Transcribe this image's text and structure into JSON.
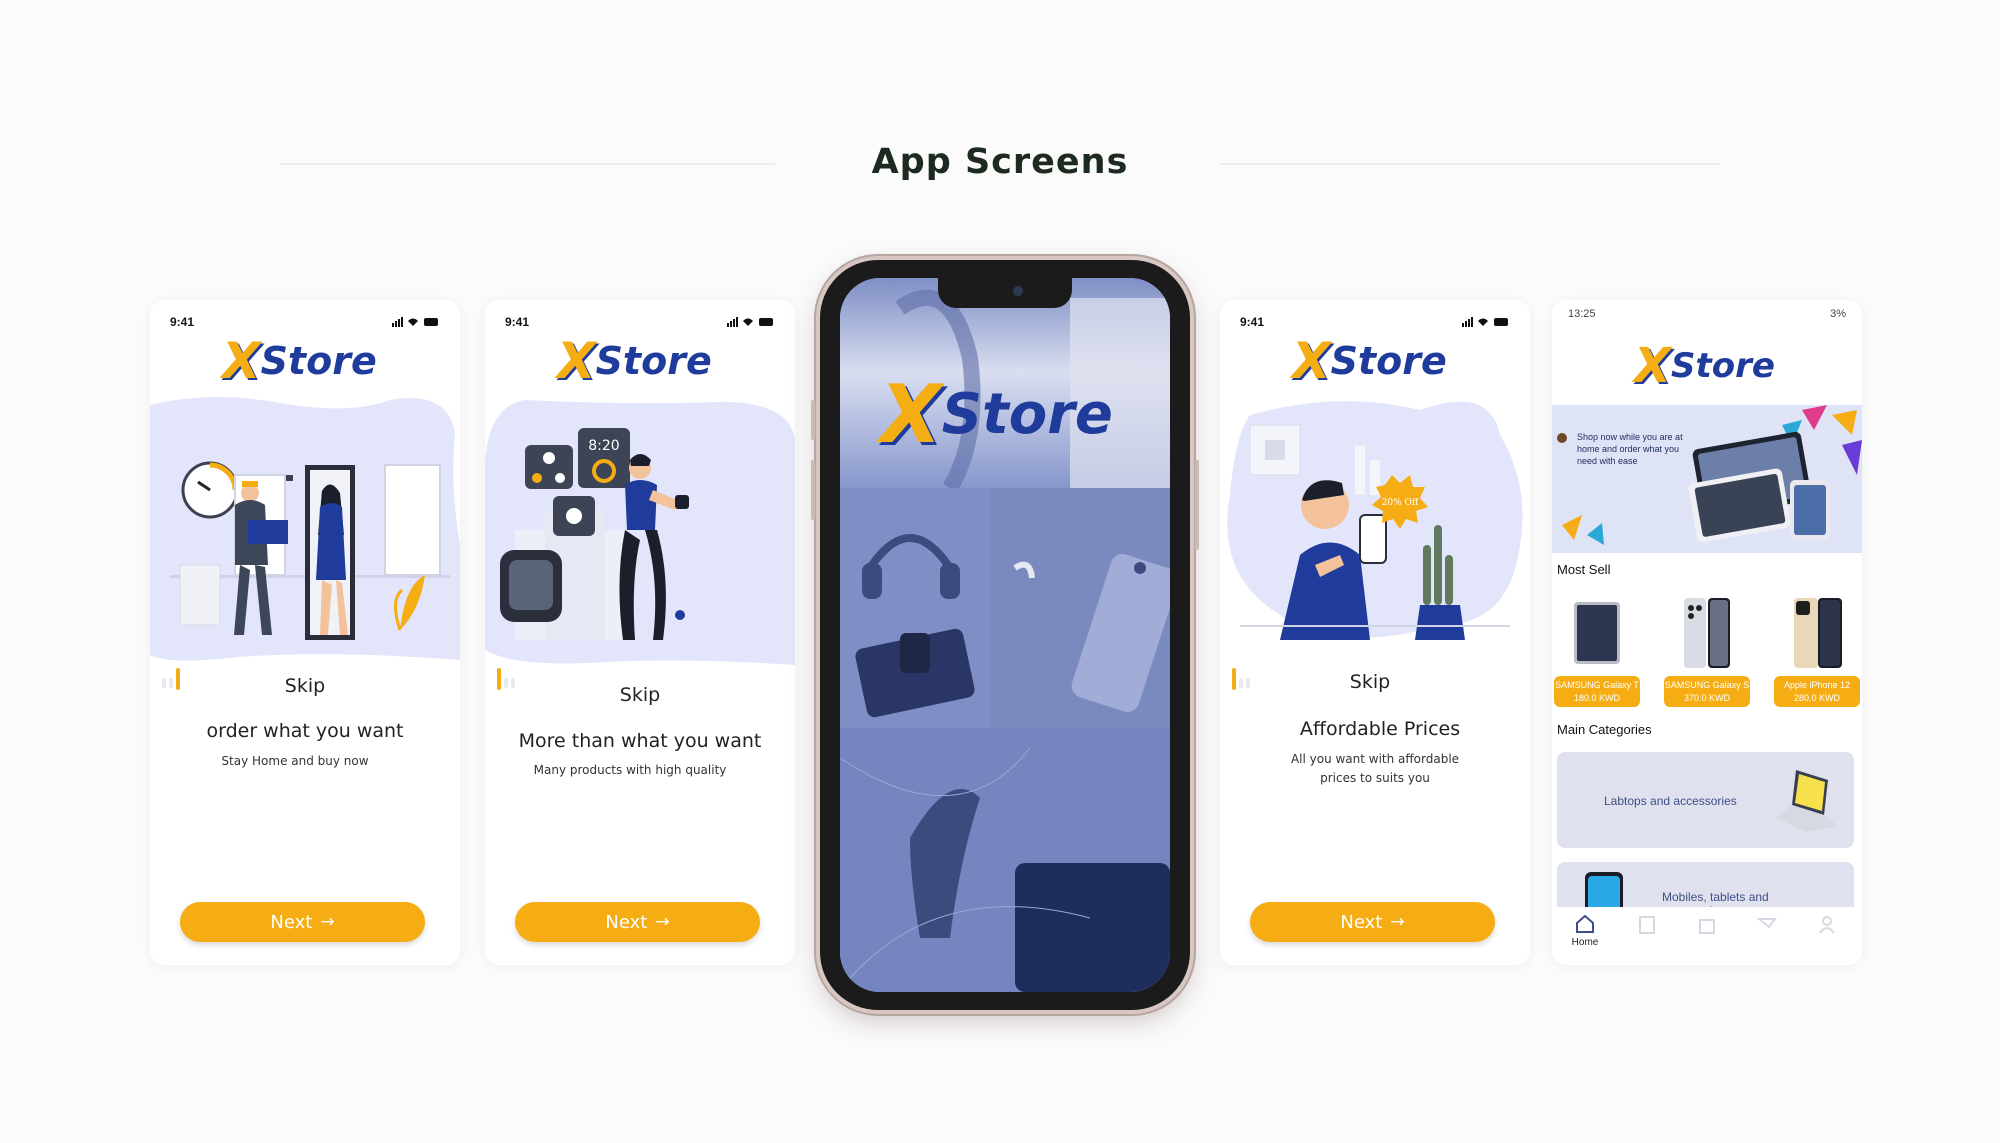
{
  "page": {
    "title": "App Screens"
  },
  "brand": {
    "x_letter": "X",
    "word": "Store",
    "accent": "#f6ad13",
    "primary": "#1f3c9c",
    "blob": "#e3e6fb"
  },
  "onboarding": [
    {
      "time": "9:41",
      "skip": "Skip",
      "headline": "order what you want",
      "sub": "Stay Home and buy now",
      "next": "Next",
      "illustration": "delivery-illustration",
      "progress_step": 1
    },
    {
      "time": "9:41",
      "skip": "Skip",
      "headline": "More than what you want",
      "sub": "Many products with high quality",
      "next": "Next",
      "illustration": "smartwatch-illustration",
      "progress_step": 1
    },
    {
      "time": "9:41",
      "skip": "Skip",
      "headline": "Affordable Prices",
      "sub": "All you want with affordable prices to suits you",
      "next": "Next",
      "illustration": "discount-illustration",
      "discount": "20% Off",
      "progress_step": 1
    }
  ],
  "illustrations": {
    "watch_time": "8:20"
  },
  "splash": {
    "x_letter": "X",
    "word": "Store"
  },
  "home": {
    "time": "13:25",
    "battery": "3%",
    "banner_text": "Shop now while you are at home and order what you need with ease",
    "most_sell_title": "Most Sell",
    "products": [
      {
        "name": "SAMSUNG Galaxy T",
        "price": "180.0 KWD"
      },
      {
        "name": "SAMSUNG Galaxy S",
        "price": "370.0 KWD"
      },
      {
        "name": "Apple iPhone 12",
        "price": "280.0 KWD"
      }
    ],
    "categories_title": "Main Categories",
    "categories": [
      {
        "label": "Labtops and accessories",
        "icon": "laptop-icon"
      },
      {
        "label": "Mobiles, tablets and accessories",
        "icon": "phone-icon"
      }
    ],
    "tabs": [
      {
        "label": "Home",
        "icon": "home-icon"
      },
      {
        "label": "",
        "icon": "building-icon"
      },
      {
        "label": "",
        "icon": "bag-icon"
      },
      {
        "label": "",
        "icon": "cart-icon"
      },
      {
        "label": "",
        "icon": "user-icon"
      }
    ]
  }
}
